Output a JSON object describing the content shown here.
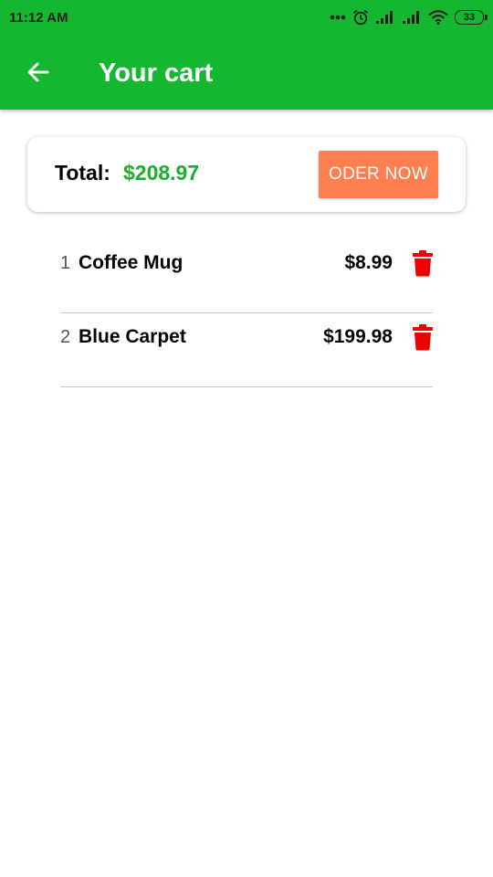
{
  "status_bar": {
    "time": "11:12 AM",
    "battery": "33",
    "icons": [
      "more-dots-icon",
      "alarm-icon",
      "signal-icon",
      "signal-icon",
      "wifi-icon",
      "battery-icon"
    ]
  },
  "app_bar": {
    "title": "Your cart",
    "back_icon": "arrow-left-icon"
  },
  "summary": {
    "total_label": "Total:",
    "total_amount": "$208.97",
    "order_button_label": "ODER NOW"
  },
  "cart": {
    "items": [
      {
        "index": "1",
        "name": "Coffee Mug",
        "price": "$8.99"
      },
      {
        "index": "2",
        "name": "Blue Carpet",
        "price": "$199.98"
      }
    ]
  },
  "colors": {
    "primary": "#16b730",
    "total_amount": "#18b02c",
    "order_button": "#ff7f50",
    "delete_icon": "#ee0000"
  }
}
